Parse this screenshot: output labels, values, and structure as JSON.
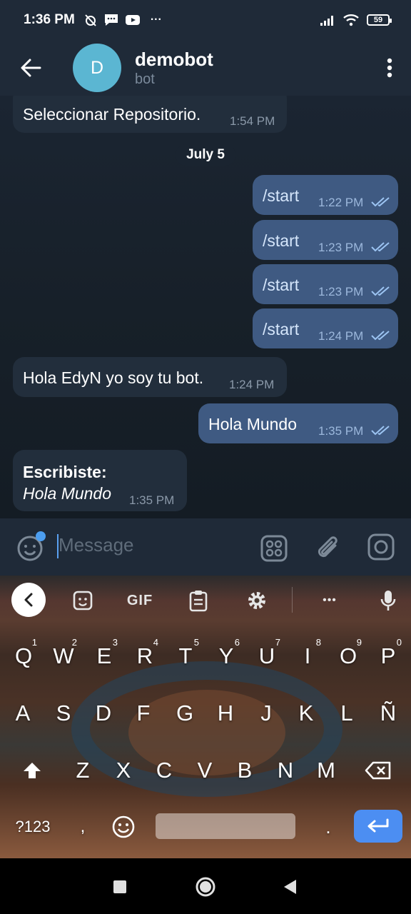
{
  "status_bar": {
    "time": "1:36 PM",
    "battery": "59",
    "more": "···"
  },
  "header": {
    "avatar_letter": "D",
    "title": "demobot",
    "subtitle": "bot"
  },
  "chat": {
    "messages": [
      {
        "direction": "in",
        "text": "Seleccionar Repositorio.",
        "time": "1:54 PM"
      },
      {
        "direction": "out",
        "text": "/start",
        "time": "1:22 PM"
      },
      {
        "direction": "out",
        "text": "/start",
        "time": "1:23 PM"
      },
      {
        "direction": "out",
        "text": "/start",
        "time": "1:23 PM"
      },
      {
        "direction": "out",
        "text": "/start",
        "time": "1:24 PM"
      },
      {
        "direction": "in",
        "text": "Hola EdyN yo soy tu bot.",
        "time": "1:24 PM"
      },
      {
        "direction": "out",
        "text": "Hola Mundo",
        "time": "1:35 PM"
      },
      {
        "direction": "in",
        "title": "Escribiste:",
        "quote": "Hola Mundo",
        "time": "1:35 PM"
      }
    ],
    "date_separator": "July 5"
  },
  "composer": {
    "placeholder": "Message"
  },
  "keyboard": {
    "toolbar": {
      "gif_label": "GIF",
      "more": "•••"
    },
    "row1": [
      "Q",
      "W",
      "E",
      "R",
      "T",
      "Y",
      "U",
      "I",
      "O",
      "P"
    ],
    "row1_hints": [
      "1",
      "2",
      "3",
      "4",
      "5",
      "6",
      "7",
      "8",
      "9",
      "0"
    ],
    "row2": [
      "A",
      "S",
      "D",
      "F",
      "G",
      "H",
      "J",
      "K",
      "L",
      "Ñ"
    ],
    "row3": [
      "Z",
      "X",
      "C",
      "V",
      "B",
      "N",
      "M"
    ],
    "symbols_label": "?123",
    "comma": ",",
    "period": "."
  },
  "colors": {
    "accent": "#4c8ef2",
    "outgoing_bubble": "#3f5a82",
    "incoming_bubble": "#222e3c",
    "avatar": "#5bb6d2"
  }
}
